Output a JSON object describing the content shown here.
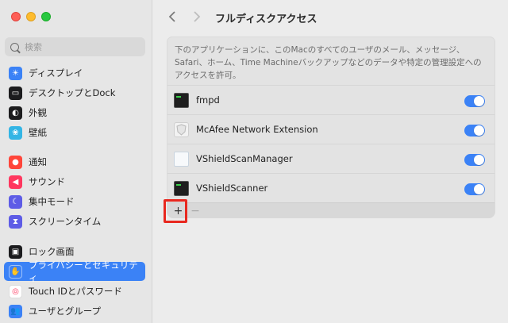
{
  "sidebar": {
    "search_placeholder": "検索",
    "items": [
      {
        "label": "ディスプレイ",
        "icon": "display-icon",
        "color": "#3b82f6"
      },
      {
        "label": "デスクトップとDock",
        "icon": "dock-icon",
        "color": "#1c1c1e"
      },
      {
        "label": "外観",
        "icon": "appearance-icon",
        "color": "#1c1c1e"
      },
      {
        "label": "壁紙",
        "icon": "wallpaper-icon",
        "color": "#33b5e5"
      },
      {
        "label": "通知",
        "icon": "notifications-icon",
        "color": "#ff453a"
      },
      {
        "label": "サウンド",
        "icon": "sound-icon",
        "color": "#ff375f"
      },
      {
        "label": "集中モード",
        "icon": "focus-moon-icon",
        "color": "#5e5ce6"
      },
      {
        "label": "スクリーンタイム",
        "icon": "screentime-hourglass-icon",
        "color": "#5e5ce6"
      },
      {
        "label": "ロック画面",
        "icon": "lock-icon",
        "color": "#1c1c1e"
      },
      {
        "label": "プライバシーとセキュリティ",
        "icon": "privacy-hand-icon",
        "color": "#3b82f6"
      },
      {
        "label": "Touch IDとパスワード",
        "icon": "fingerprint-icon",
        "color": "#ffffff"
      },
      {
        "label": "ユーザとグループ",
        "icon": "users-icon",
        "color": "#3b82f6"
      }
    ]
  },
  "main": {
    "title": "フルディスクアクセス",
    "description": "下のアプリケーションに、このMacのすべてのユーザのメール、メッセージ、Safari、ホーム、Time Machineバックアップなどのデータや特定の管理設定へのアクセスを許可。",
    "apps": [
      {
        "name": "fmpd",
        "icon": "terminal-icon",
        "enabled": true
      },
      {
        "name": "McAfee Network Extension",
        "icon": "shield-icon",
        "enabled": true
      },
      {
        "name": "VShieldScanManager",
        "icon": "document-icon",
        "enabled": true
      },
      {
        "name": "VShieldScanner",
        "icon": "terminal-icon",
        "enabled": true
      }
    ],
    "add_label": "+",
    "remove_label": "−"
  },
  "accent_color": "#3b82f6",
  "highlight_color": "#e8281f"
}
